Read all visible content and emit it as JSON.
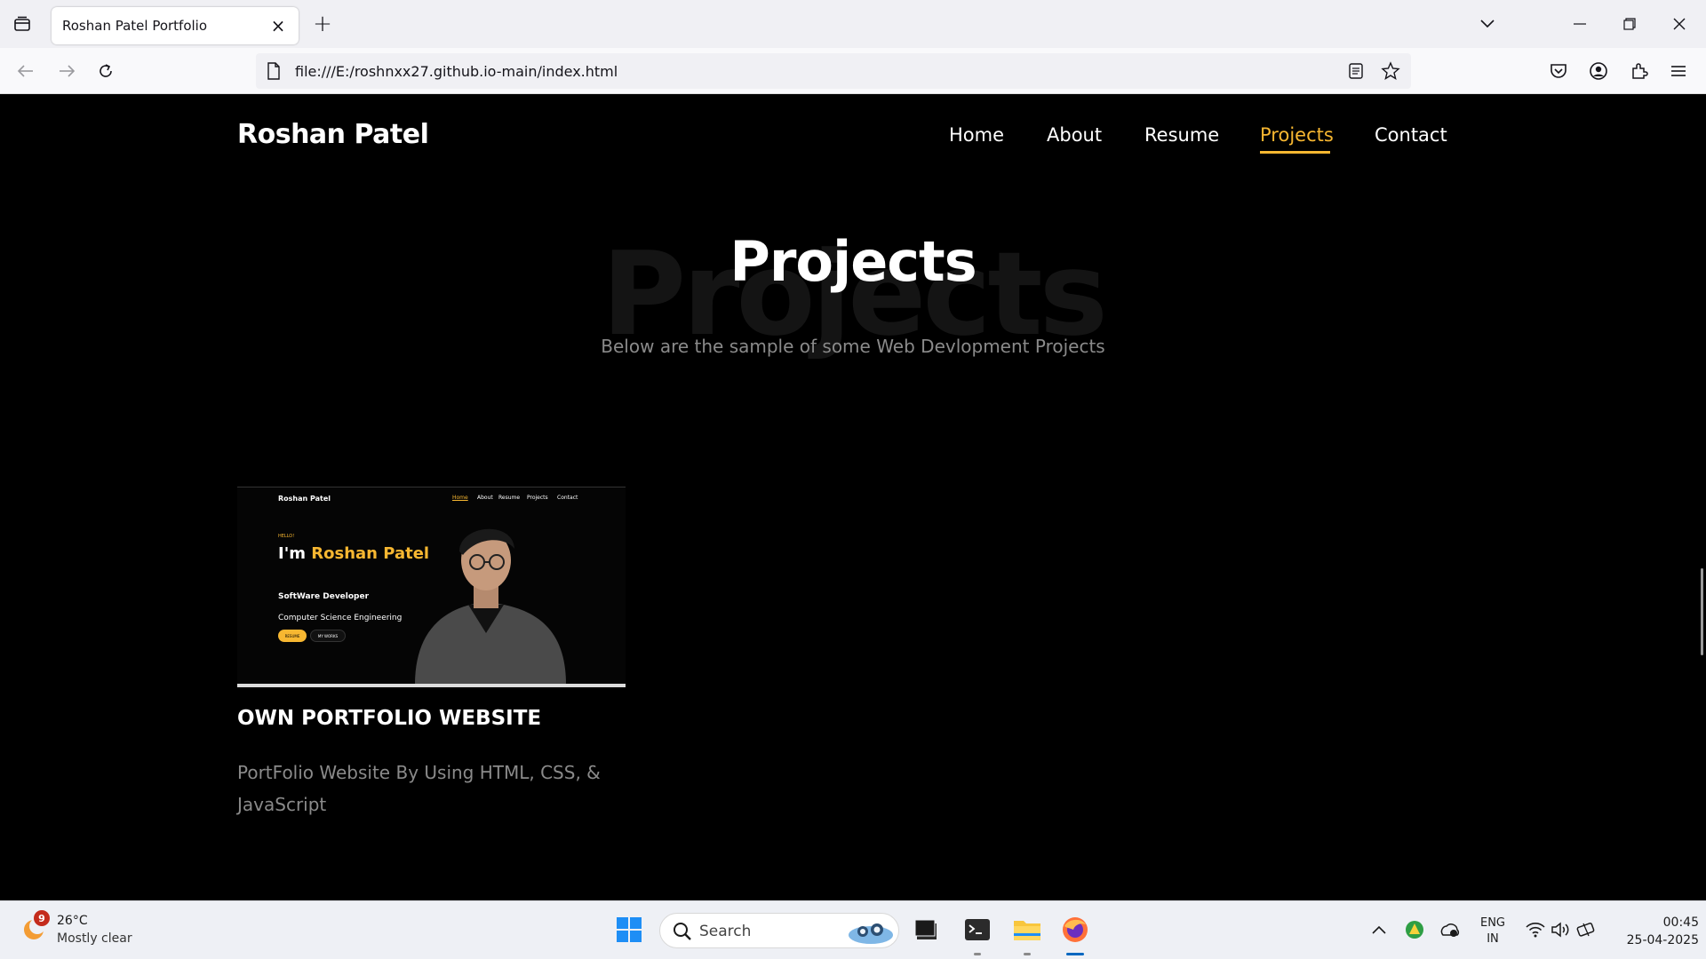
{
  "browser": {
    "tab_title": "Roshan Patel Portfolio",
    "url": "file:///E:/roshnxx27.github.io-main/index.html"
  },
  "site": {
    "logo": "Roshan Patel",
    "nav": [
      "Home",
      "About",
      "Resume",
      "Projects",
      "Contact"
    ],
    "active_nav": "Projects",
    "accent_color": "#f7b731"
  },
  "projects_section": {
    "bg_text": "Projects",
    "title": "Projects",
    "subtitle": "Below are the sample of some Web Devlopment Projects"
  },
  "project_card": {
    "thumbnail": {
      "logo": "Roshan Patel",
      "menu": [
        "Home",
        "About",
        "Resume",
        "Projects",
        "Contact"
      ],
      "hello": "HELLO!",
      "im": "I'm",
      "name": "Roshan Patel",
      "role": "SoftWare Developer",
      "edu": "Computer Science Engineering",
      "btn1": "RESUME",
      "btn2": "MY WORKS"
    },
    "title": "OWN PORTFOLIO WEBSITE",
    "description": "PortFolio Website By Using HTML, CSS, & JavaScript"
  },
  "taskbar": {
    "weather_badge": "9",
    "temperature": "26°C",
    "condition": "Mostly clear",
    "search_placeholder": "Search",
    "lang_line1": "ENG",
    "lang_line2": "IN",
    "time": "00:45",
    "date": "25-04-2025"
  },
  "icons": [
    "tab-list-icon",
    "close-icon",
    "plus-icon",
    "chevron-down-icon",
    "minimize-icon",
    "restore-icon",
    "back-icon",
    "forward-icon",
    "reload-icon",
    "page-icon",
    "reader-view-icon",
    "bookmark-star-icon",
    "pocket-icon",
    "account-icon",
    "extensions-icon",
    "menu-icon",
    "windows-start-icon",
    "search-icon",
    "task-view-icon",
    "terminal-icon",
    "file-explorer-icon",
    "firefox-icon",
    "chevron-up-icon",
    "wifi-icon",
    "volume-icon",
    "battery-icon"
  ]
}
